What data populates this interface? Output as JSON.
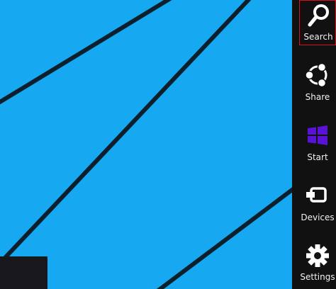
{
  "colors": {
    "desktop_background": "#16a8f1",
    "desktop_stripe": "#0b1f2c",
    "charms_background": "#111111",
    "charm_label": "#f2f2f2",
    "selection_border": "#d4131c",
    "start_logo": "#5a12d6",
    "taskbar": "#17171c"
  },
  "charms": [
    {
      "id": "search",
      "label": "Search",
      "icon": "magnifier-icon",
      "selected": true
    },
    {
      "id": "share",
      "label": "Share",
      "icon": "share-icon",
      "selected": false
    },
    {
      "id": "start",
      "label": "Start",
      "icon": "windows-logo-icon",
      "selected": false
    },
    {
      "id": "devices",
      "label": "Devices",
      "icon": "devices-icon",
      "selected": false
    },
    {
      "id": "settings",
      "label": "Settings",
      "icon": "gear-icon",
      "selected": false
    }
  ]
}
